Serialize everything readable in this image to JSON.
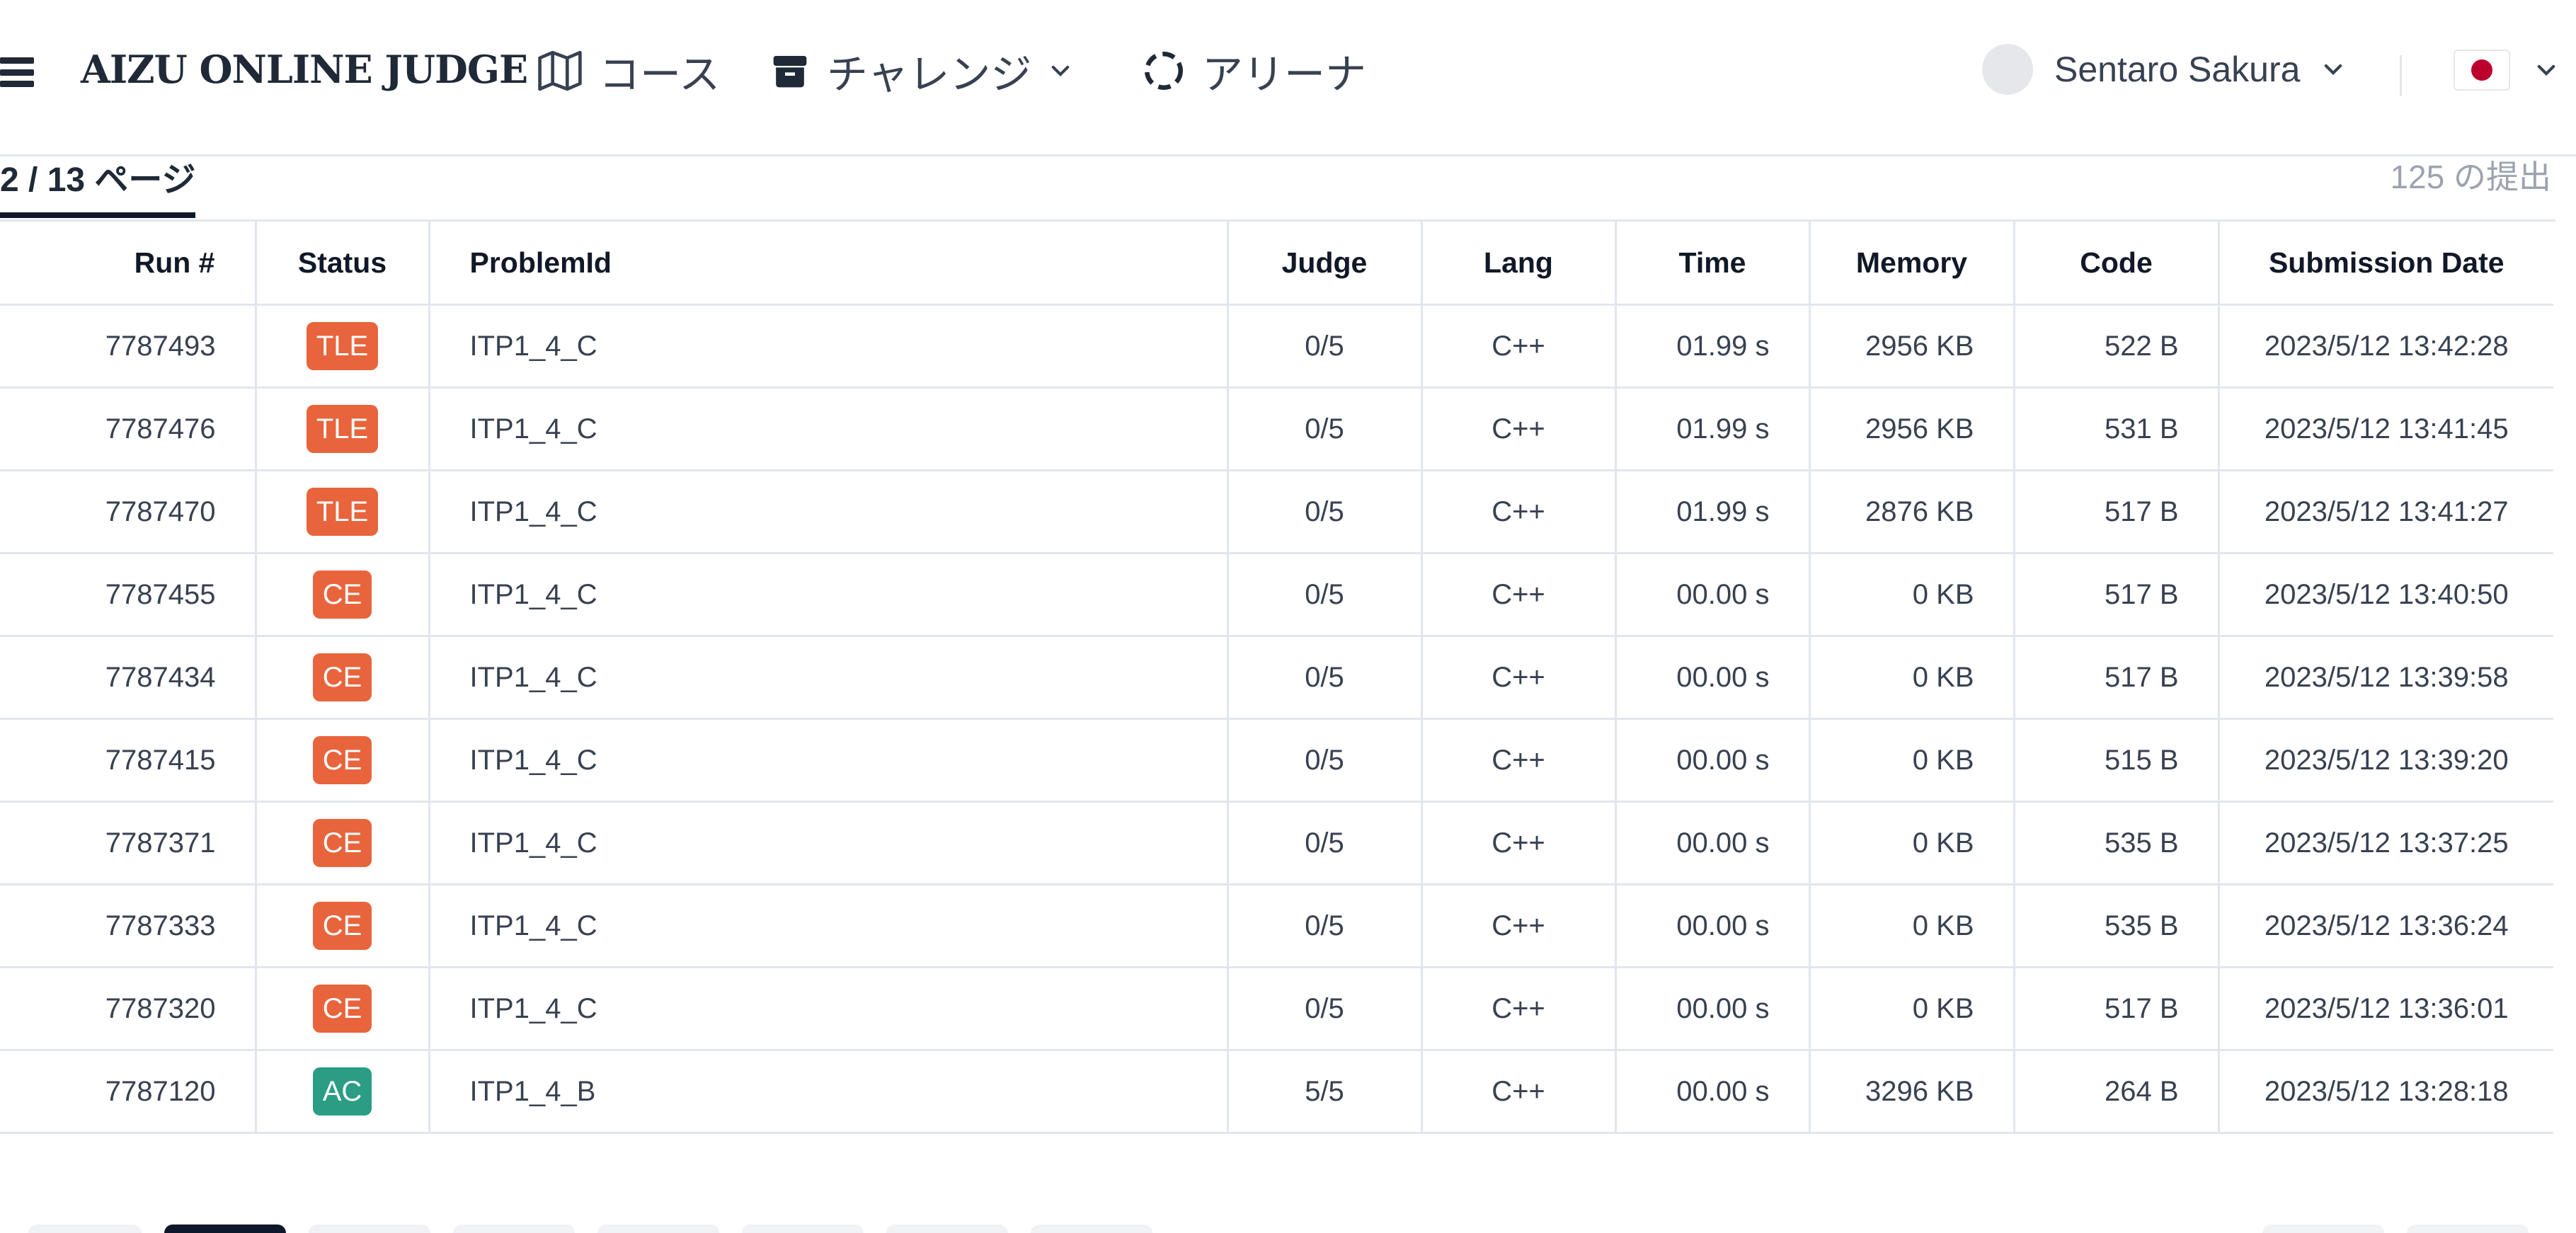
{
  "header": {
    "logo": "AIZU ONLINE JUDGE",
    "nav": [
      {
        "label": "コース",
        "icon": "map-icon"
      },
      {
        "label": "チャレンジ",
        "icon": "box-icon"
      },
      {
        "label": "アリーナ",
        "icon": "arena-icon"
      }
    ],
    "user_name": "Sentaro Sakura",
    "language_flag": "japan-flag-icon"
  },
  "subbar": {
    "page_label": "2 / 13 ページ",
    "submission_count": "125 の提出"
  },
  "table": {
    "columns": [
      "Run #",
      "Status",
      "ProblemId",
      "Judge",
      "Lang",
      "Time",
      "Memory",
      "Code",
      "Submission Date"
    ],
    "rows": [
      {
        "run": "7787493",
        "status": "TLE",
        "problem": "ITP1_4_C",
        "judge": "0/5",
        "lang": "C++",
        "time": "01.99 s",
        "memory": "2956 KB",
        "code": "522 B",
        "date": "2023/5/12 13:42:28"
      },
      {
        "run": "7787476",
        "status": "TLE",
        "problem": "ITP1_4_C",
        "judge": "0/5",
        "lang": "C++",
        "time": "01.99 s",
        "memory": "2956 KB",
        "code": "531 B",
        "date": "2023/5/12 13:41:45"
      },
      {
        "run": "7787470",
        "status": "TLE",
        "problem": "ITP1_4_C",
        "judge": "0/5",
        "lang": "C++",
        "time": "01.99 s",
        "memory": "2876 KB",
        "code": "517 B",
        "date": "2023/5/12 13:41:27"
      },
      {
        "run": "7787455",
        "status": "CE",
        "problem": "ITP1_4_C",
        "judge": "0/5",
        "lang": "C++",
        "time": "00.00 s",
        "memory": "0 KB",
        "code": "517 B",
        "date": "2023/5/12 13:40:50"
      },
      {
        "run": "7787434",
        "status": "CE",
        "problem": "ITP1_4_C",
        "judge": "0/5",
        "lang": "C++",
        "time": "00.00 s",
        "memory": "0 KB",
        "code": "517 B",
        "date": "2023/5/12 13:39:58"
      },
      {
        "run": "7787415",
        "status": "CE",
        "problem": "ITP1_4_C",
        "judge": "0/5",
        "lang": "C++",
        "time": "00.00 s",
        "memory": "0 KB",
        "code": "515 B",
        "date": "2023/5/12 13:39:20"
      },
      {
        "run": "7787371",
        "status": "CE",
        "problem": "ITP1_4_C",
        "judge": "0/5",
        "lang": "C++",
        "time": "00.00 s",
        "memory": "0 KB",
        "code": "535 B",
        "date": "2023/5/12 13:37:25"
      },
      {
        "run": "7787333",
        "status": "CE",
        "problem": "ITP1_4_C",
        "judge": "0/5",
        "lang": "C++",
        "time": "00.00 s",
        "memory": "0 KB",
        "code": "535 B",
        "date": "2023/5/12 13:36:24"
      },
      {
        "run": "7787320",
        "status": "CE",
        "problem": "ITP1_4_C",
        "judge": "0/5",
        "lang": "C++",
        "time": "00.00 s",
        "memory": "0 KB",
        "code": "517 B",
        "date": "2023/5/12 13:36:01"
      },
      {
        "run": "7787120",
        "status": "AC",
        "problem": "ITP1_4_B",
        "judge": "5/5",
        "lang": "C++",
        "time": "00.00 s",
        "memory": "3296 KB",
        "code": "264 B",
        "date": "2023/5/12 13:28:18"
      }
    ]
  },
  "colors": {
    "tle": "#e8643c",
    "ce": "#e8643c",
    "ac": "#2a9d84",
    "active_page": "#0f172a"
  }
}
